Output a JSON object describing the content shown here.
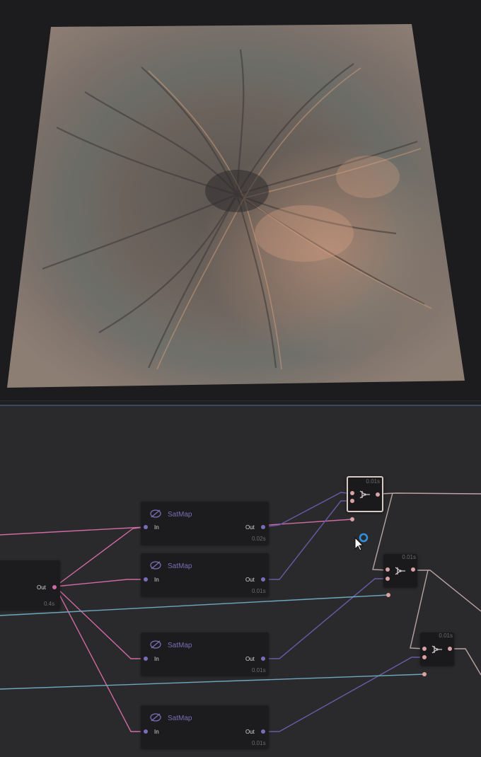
{
  "viewport": {
    "name": "terrain-3d-viewport",
    "colors": {
      "background": "#1c1c1e",
      "terrain_base": "#7d7268",
      "terrain_dark": "#3e3e40",
      "terrain_light": "#c8977a"
    }
  },
  "graph": {
    "colors": {
      "background": "#2a2a2c",
      "wire_pink": "#cf6aa3",
      "wire_purple": "#6a5aa8",
      "wire_blue": "#6fa8bd",
      "wire_beige": "#bba3a1",
      "port_purple": "#7a6cb9",
      "port_pink": "#d9a2a4",
      "cursor_ring": "#2f8fe0"
    },
    "source_node": {
      "out_label": "Out",
      "time": "0.4s"
    },
    "satmap_nodes": [
      {
        "title": "SatMap",
        "in_label": "In",
        "out_label": "Out",
        "time": "0.02s"
      },
      {
        "title": "SatMap",
        "in_label": "In",
        "out_label": "Out",
        "time": "0.01s"
      },
      {
        "title": "SatMap",
        "in_label": "In",
        "out_label": "Out",
        "time": "0.01s"
      },
      {
        "title": "SatMap",
        "in_label": "In",
        "out_label": "Out",
        "time": "0.01s"
      }
    ],
    "combine_nodes": [
      {
        "icon": "combine-icon",
        "time": "0.01s",
        "selected": true
      },
      {
        "icon": "combine-icon",
        "time": "0.01s",
        "selected": false
      },
      {
        "icon": "combine-icon",
        "time": "0.01s",
        "selected": false
      }
    ]
  }
}
